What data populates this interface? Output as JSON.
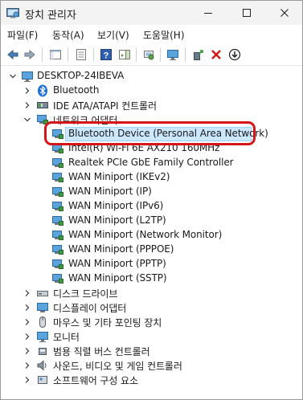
{
  "window": {
    "title": "장치 관리자"
  },
  "menu": [
    "파일(F)",
    "동작(A)",
    "보기(V)",
    "도움말(H)"
  ],
  "tree": {
    "root": "DESKTOP-24IBEVA",
    "bluetooth": "Bluetooth",
    "ide": "IDE ATA/ATAPI 컨트롤러",
    "network": "네트워크 어댑터",
    "net_children": [
      "Bluetooth Device (Personal Area Network)",
      "Intel(R) Wi-Fi 6E AX210 160MHz",
      "Realtek PCIe GbE Family Controller",
      "WAN Miniport (IKEv2)",
      "WAN Miniport (IP)",
      "WAN Miniport (IPv6)",
      "WAN Miniport (L2TP)",
      "WAN Miniport (Network Monitor)",
      "WAN Miniport (PPPOE)",
      "WAN Miniport (PPTP)",
      "WAN Miniport (SSTP)"
    ],
    "disk": "디스크 드라이브",
    "display": "디스플레이 어댑터",
    "mouse": "마우스 및 기타 포인팅 장치",
    "monitor": "모니터",
    "usb": "범용 직렬 버스 컨트롤러",
    "sound": "사운드, 비디오 및 게임 컨트롤러",
    "software": "소프트웨어 구성 요소"
  },
  "colors": {
    "highlight_border": "#d4161a",
    "selection": "#cce8ff",
    "bluetooth": "#1a6fd6"
  }
}
